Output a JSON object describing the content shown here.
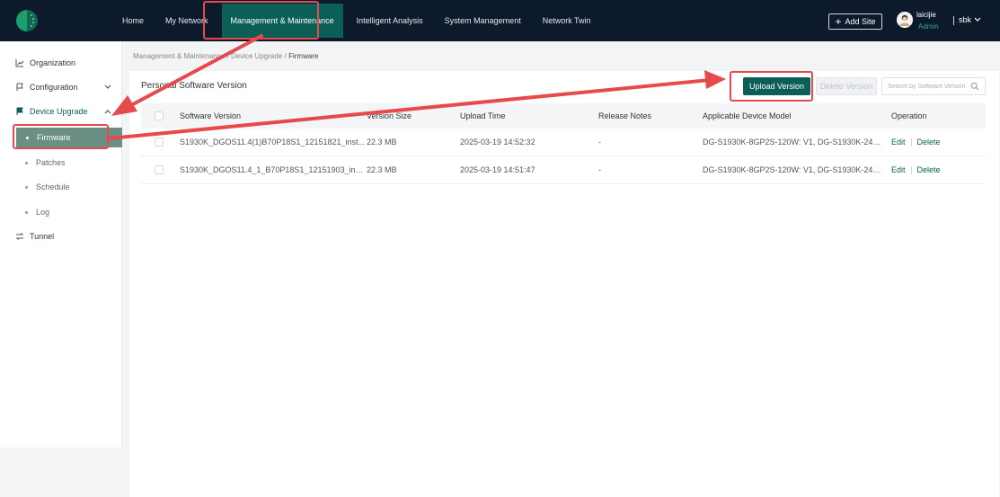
{
  "topbar": {
    "nav": [
      {
        "label": "Home"
      },
      {
        "label": "My Network"
      },
      {
        "label": "Management & Maintenance",
        "active": true
      },
      {
        "label": "Intelligent Analysis"
      },
      {
        "label": "System Management"
      },
      {
        "label": "Network Twin"
      }
    ],
    "add_site_label": "Add Site",
    "user_name": "laicijie",
    "user_role": "Admin",
    "tenant": "sbk"
  },
  "sidebar": {
    "organization": "Organization",
    "configuration": "Configuration",
    "device_upgrade": "Device Upgrade",
    "sub_items": [
      "Firmware",
      "Patches",
      "Schedule",
      "Log"
    ],
    "tunnel": "Tunnel"
  },
  "breadcrumb": {
    "part1": "Management & Maintenance",
    "sep": "/",
    "part2": "Device Upgrade",
    "part3": "Firmware"
  },
  "panel": {
    "title": "Personal Software Version",
    "upload_label": "Upload Version",
    "delete_label": "Delete Version",
    "search_placeholder": "Search by Software Version"
  },
  "table": {
    "columns": [
      "Software Version",
      "Version Size",
      "Upload Time",
      "Release Notes",
      "Applicable Device Model",
      "Operation"
    ],
    "rows": [
      {
        "version": "S1930K_DGOS11.4(1)B70P18S1_12151821_inst...",
        "size": "22.3 MB",
        "time": "2025-03-19 14:52:32",
        "notes": "-",
        "model": "DG-S1930K-8GP2S-120W: V1, DG-S1930K-24GP...",
        "edit": "Edit",
        "delete": "Delete"
      },
      {
        "version": "S1930K_DGOS11.4_1_B70P18S1_12151903_inst...",
        "size": "22.3 MB",
        "time": "2025-03-19 14:51:47",
        "notes": "-",
        "model": "DG-S1930K-8GP2S-120W: V1, DG-S1930K-24GP...",
        "edit": "Edit",
        "delete": "Delete"
      }
    ]
  },
  "colors": {
    "topbar_bg": "#0d1a2b",
    "brand_green": "#0b5f56",
    "annotation_red": "#e64a4a"
  }
}
